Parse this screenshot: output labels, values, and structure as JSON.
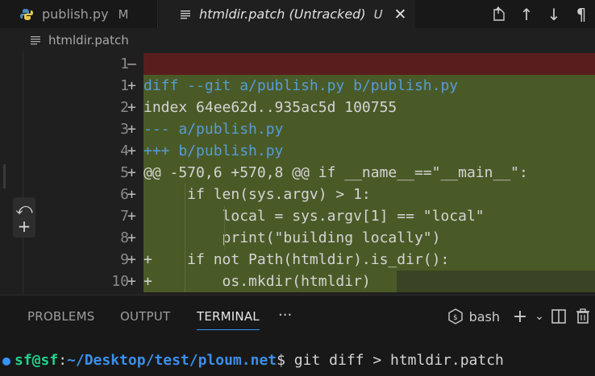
{
  "tabs": [
    {
      "label": "publish.py",
      "status": "M",
      "icon": "python-icon"
    },
    {
      "label": "htmldir.patch (Untracked)",
      "status": "U",
      "icon": "lines-icon",
      "active": true
    }
  ],
  "tab_actions": [
    "open-changes-icon",
    "arrow-up-icon",
    "arrow-down-icon",
    "pilcrow-icon"
  ],
  "breadcrumb": {
    "file": "htmldir.patch"
  },
  "editor": {
    "lines": [
      {
        "num": "1",
        "marker": "—",
        "text": "",
        "kind": "deleted"
      },
      {
        "num": "1",
        "marker": "+",
        "text": "diff --git a/publish.py b/publish.py",
        "kind": "added"
      },
      {
        "num": "2",
        "marker": "+",
        "text": "index 64ee62d..935ac5d 100755",
        "kind": "added"
      },
      {
        "num": "3",
        "marker": "+",
        "text": "--- a/publish.py",
        "kind": "added"
      },
      {
        "num": "4",
        "marker": "+",
        "text": "+++ b/publish.py",
        "kind": "added"
      },
      {
        "num": "5",
        "marker": "+",
        "text": "@@ -570,6 +570,8 @@ if __name__==\"__main__\":",
        "kind": "added"
      },
      {
        "num": "6",
        "marker": "+",
        "text": "     if len(sys.argv) > 1:",
        "kind": "added"
      },
      {
        "num": "7",
        "marker": "+",
        "text": "         local = sys.argv[1] == \"local\"",
        "kind": "added"
      },
      {
        "num": "8",
        "marker": "+",
        "text": "         print(\"building locally\")",
        "kind": "added"
      },
      {
        "num": "9",
        "marker": "+",
        "text": "+    if not Path(htmldir).is_dir():",
        "kind": "added"
      },
      {
        "num": "10",
        "marker": "+",
        "text": "+        os.mkdir(htmldir)",
        "kind": "added"
      }
    ]
  },
  "panel": {
    "tabs": [
      "PROBLEMS",
      "OUTPUT",
      "TERMINAL"
    ],
    "active_tab": "TERMINAL",
    "more": "···",
    "shell": "bash"
  },
  "terminal": {
    "user": "sf@sf",
    "path": "~/Desktop/test/ploum.net",
    "prompt_symbol": "$",
    "command": " git diff > htmldir.patch"
  },
  "colors": {
    "added_bg": "#4a5a27",
    "deleted_bg": "#5a1d1d",
    "accent": "#3794ff"
  }
}
